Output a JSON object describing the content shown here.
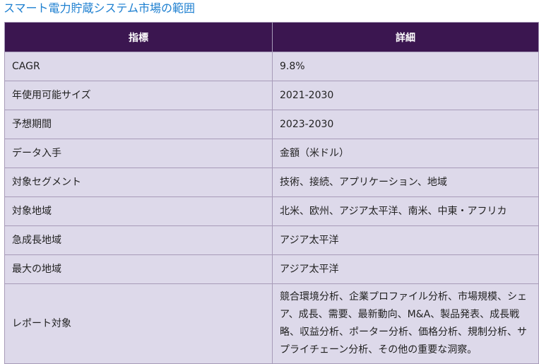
{
  "title": "スマート電力貯蔵システム市場の範囲",
  "table": {
    "headers": [
      "指標",
      "詳細"
    ],
    "rows": [
      {
        "metric": "CAGR",
        "detail": "9.8%"
      },
      {
        "metric": "年使用可能サイズ",
        "detail": "2021-2030"
      },
      {
        "metric": "予想期間",
        "detail": "2023-2030"
      },
      {
        "metric": "データ入手",
        "detail": "金額（米ドル）"
      },
      {
        "metric": "対象セグメント",
        "detail": "技術、接続、アプリケーション、地域"
      },
      {
        "metric": "対象地域",
        "detail": "北米、欧州、アジア太平洋、南米、中東・アフリカ"
      },
      {
        "metric": "急成長地域",
        "detail": "アジア太平洋"
      },
      {
        "metric": "最大の地域",
        "detail": "アジア太平洋"
      },
      {
        "metric": "レポート対象",
        "detail": "競合環境分析、企業プロファイル分析、市場規模、シェア、成長、需要、最新動向、M&A、製品発表、成長戦略、収益分析、ポーター分析、価格分析、規制分析、サプライチェーン分析、その他の重要な洞察。"
      }
    ]
  }
}
